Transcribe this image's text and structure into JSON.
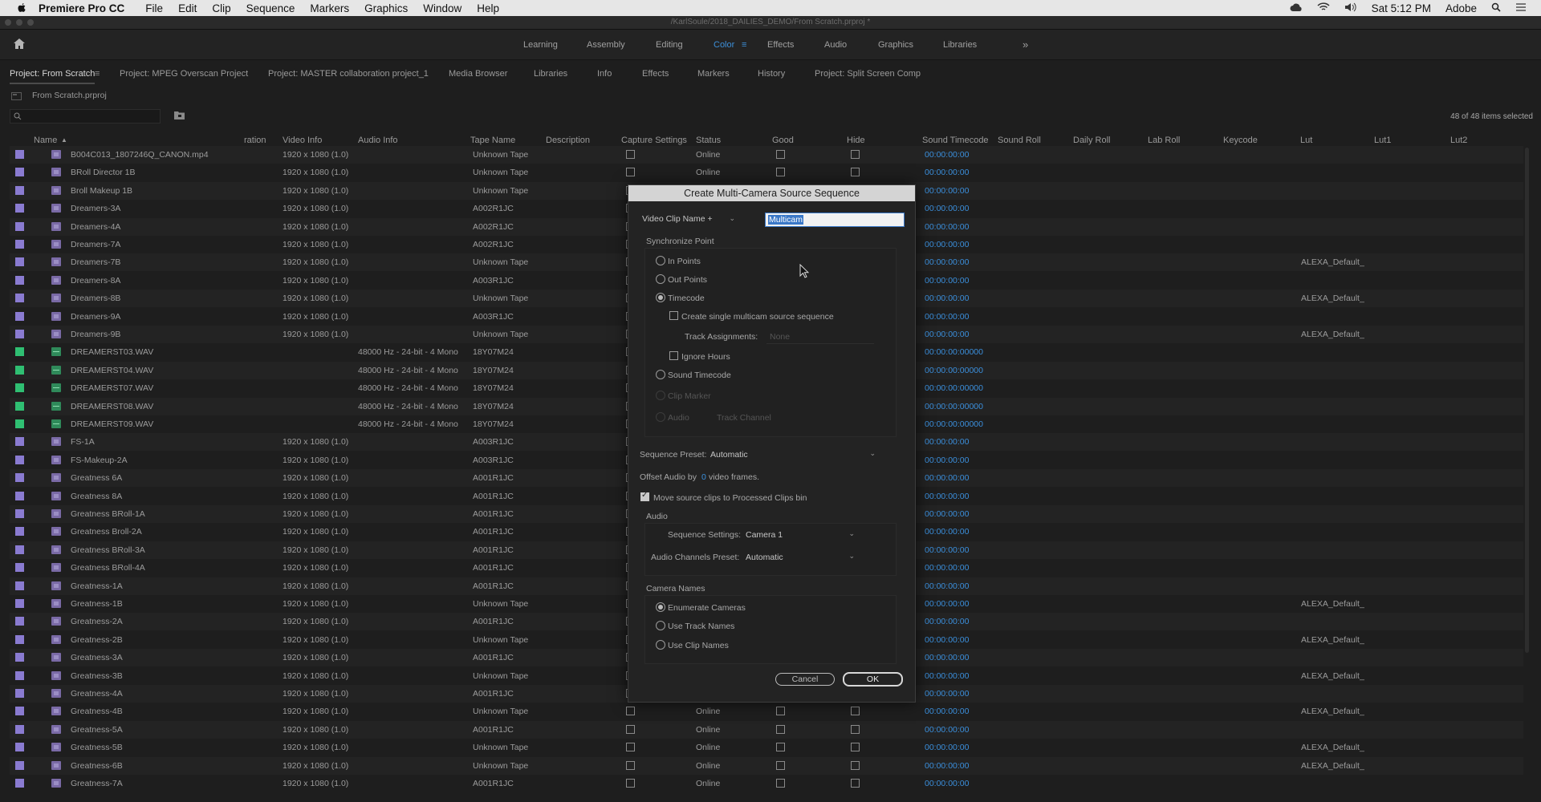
{
  "menubar": {
    "app": "Premiere Pro CC",
    "items": [
      "File",
      "Edit",
      "Clip",
      "Sequence",
      "Markers",
      "Graphics",
      "Window",
      "Help"
    ],
    "time": "Sat 5:12 PM",
    "user": "Adobe"
  },
  "titlebar": {
    "path": "/KarlSoule/2018_DAILIES_DEMO/From Scratch.prproj *"
  },
  "workspaces": [
    "Learning",
    "Assembly",
    "Editing",
    "Color",
    "Effects",
    "Audio",
    "Graphics",
    "Libraries"
  ],
  "active_workspace": "Color",
  "panel_tabs": [
    "Project: From Scratch",
    "Project: MPEG Overscan Project",
    "Project: MASTER collaboration project_1",
    "Media Browser",
    "Libraries",
    "Info",
    "Effects",
    "Markers",
    "History",
    "Project: Split Screen Comp"
  ],
  "project": {
    "file": "From Scratch.prproj",
    "selection": "48 of 48 items selected"
  },
  "columns": [
    "Name",
    "ration",
    "Video Info",
    "Audio Info",
    "Tape Name",
    "Description",
    "Capture Settings",
    "Status",
    "Good",
    "Hide",
    "Sound Timecode",
    "Sound Roll",
    "Daily Roll",
    "Lab Roll",
    "Keycode",
    "Lut",
    "Lut1",
    "Lut2"
  ],
  "rows": [
    {
      "name": "B004C013_1807246Q_CANON.mp4",
      "type": "video",
      "video": "1920 x 1080 (1.0)",
      "audio": "",
      "tape": "Unknown Tape",
      "status": "Online",
      "tc": "00:00:00:00",
      "lut": ""
    },
    {
      "name": "BRoll Director 1B",
      "type": "video",
      "video": "1920 x 1080 (1.0)",
      "audio": "",
      "tape": "Unknown Tape",
      "status": "Online",
      "tc": "00:00:00:00",
      "lut": ""
    },
    {
      "name": "Broll Makeup 1B",
      "type": "video",
      "video": "1920 x 1080 (1.0)",
      "audio": "",
      "tape": "Unknown Tape",
      "status": "",
      "tc": "00:00:00:00",
      "lut": ""
    },
    {
      "name": "Dreamers-3A",
      "type": "video",
      "video": "1920 x 1080 (1.0)",
      "audio": "",
      "tape": "A002R1JC",
      "status": "",
      "tc": "00:00:00:00",
      "lut": ""
    },
    {
      "name": "Dreamers-4A",
      "type": "video",
      "video": "1920 x 1080 (1.0)",
      "audio": "",
      "tape": "A002R1JC",
      "status": "",
      "tc": "00:00:00:00",
      "lut": ""
    },
    {
      "name": "Dreamers-7A",
      "type": "video",
      "video": "1920 x 1080 (1.0)",
      "audio": "",
      "tape": "A002R1JC",
      "status": "",
      "tc": "00:00:00:00",
      "lut": ""
    },
    {
      "name": "Dreamers-7B",
      "type": "video",
      "video": "1920 x 1080 (1.0)",
      "audio": "",
      "tape": "Unknown Tape",
      "status": "",
      "tc": "00:00:00:00",
      "lut": "ALEXA_Default_"
    },
    {
      "name": "Dreamers-8A",
      "type": "video",
      "video": "1920 x 1080 (1.0)",
      "audio": "",
      "tape": "A003R1JC",
      "status": "",
      "tc": "00:00:00:00",
      "lut": ""
    },
    {
      "name": "Dreamers-8B",
      "type": "video",
      "video": "1920 x 1080 (1.0)",
      "audio": "",
      "tape": "Unknown Tape",
      "status": "",
      "tc": "00:00:00:00",
      "lut": "ALEXA_Default_"
    },
    {
      "name": "Dreamers-9A",
      "type": "video",
      "video": "1920 x 1080 (1.0)",
      "audio": "",
      "tape": "A003R1JC",
      "status": "",
      "tc": "00:00:00:00",
      "lut": ""
    },
    {
      "name": "Dreamers-9B",
      "type": "video",
      "video": "1920 x 1080 (1.0)",
      "audio": "",
      "tape": "Unknown Tape",
      "status": "",
      "tc": "00:00:00:00",
      "lut": "ALEXA_Default_"
    },
    {
      "name": "DREAMERST03.WAV",
      "type": "audio",
      "video": "",
      "audio": "48000 Hz - 24-bit - 4 Mono",
      "tape": "18Y07M24",
      "status": "",
      "tc": "00:00:00:00000",
      "lut": ""
    },
    {
      "name": "DREAMERST04.WAV",
      "type": "audio",
      "video": "",
      "audio": "48000 Hz - 24-bit - 4 Mono",
      "tape": "18Y07M24",
      "status": "",
      "tc": "00:00:00:00000",
      "lut": ""
    },
    {
      "name": "DREAMERST07.WAV",
      "type": "audio",
      "video": "",
      "audio": "48000 Hz - 24-bit - 4 Mono",
      "tape": "18Y07M24",
      "status": "",
      "tc": "00:00:00:00000",
      "lut": ""
    },
    {
      "name": "DREAMERST08.WAV",
      "type": "audio",
      "video": "",
      "audio": "48000 Hz - 24-bit - 4 Mono",
      "tape": "18Y07M24",
      "status": "",
      "tc": "00:00:00:00000",
      "lut": ""
    },
    {
      "name": "DREAMERST09.WAV",
      "type": "audio",
      "video": "",
      "audio": "48000 Hz - 24-bit - 4 Mono",
      "tape": "18Y07M24",
      "status": "",
      "tc": "00:00:00:00000",
      "lut": ""
    },
    {
      "name": "FS-1A",
      "type": "video",
      "video": "1920 x 1080 (1.0)",
      "audio": "",
      "tape": "A003R1JC",
      "status": "",
      "tc": "00:00:00:00",
      "lut": ""
    },
    {
      "name": "FS-Makeup-2A",
      "type": "video",
      "video": "1920 x 1080 (1.0)",
      "audio": "",
      "tape": "A003R1JC",
      "status": "",
      "tc": "00:00:00:00",
      "lut": ""
    },
    {
      "name": "Greatness 6A",
      "type": "video",
      "video": "1920 x 1080 (1.0)",
      "audio": "",
      "tape": "A001R1JC",
      "status": "",
      "tc": "00:00:00:00",
      "lut": ""
    },
    {
      "name": "Greatness 8A",
      "type": "video",
      "video": "1920 x 1080 (1.0)",
      "audio": "",
      "tape": "A001R1JC",
      "status": "",
      "tc": "00:00:00:00",
      "lut": ""
    },
    {
      "name": "Greatness BRoll-1A",
      "type": "video",
      "video": "1920 x 1080 (1.0)",
      "audio": "",
      "tape": "A001R1JC",
      "status": "",
      "tc": "00:00:00:00",
      "lut": ""
    },
    {
      "name": "Greatness Broll-2A",
      "type": "video",
      "video": "1920 x 1080 (1.0)",
      "audio": "",
      "tape": "A001R1JC",
      "status": "",
      "tc": "00:00:00:00",
      "lut": ""
    },
    {
      "name": "Greatness BRoll-3A",
      "type": "video",
      "video": "1920 x 1080 (1.0)",
      "audio": "",
      "tape": "A001R1JC",
      "status": "",
      "tc": "00:00:00:00",
      "lut": ""
    },
    {
      "name": "Greatness BRoll-4A",
      "type": "video",
      "video": "1920 x 1080 (1.0)",
      "audio": "",
      "tape": "A001R1JC",
      "status": "",
      "tc": "00:00:00:00",
      "lut": ""
    },
    {
      "name": "Greatness-1A",
      "type": "video",
      "video": "1920 x 1080 (1.0)",
      "audio": "",
      "tape": "A001R1JC",
      "status": "",
      "tc": "00:00:00:00",
      "lut": ""
    },
    {
      "name": "Greatness-1B",
      "type": "video",
      "video": "1920 x 1080 (1.0)",
      "audio": "",
      "tape": "Unknown Tape",
      "status": "",
      "tc": "00:00:00:00",
      "lut": "ALEXA_Default_"
    },
    {
      "name": "Greatness-2A",
      "type": "video",
      "video": "1920 x 1080 (1.0)",
      "audio": "",
      "tape": "A001R1JC",
      "status": "",
      "tc": "00:00:00:00",
      "lut": ""
    },
    {
      "name": "Greatness-2B",
      "type": "video",
      "video": "1920 x 1080 (1.0)",
      "audio": "",
      "tape": "Unknown Tape",
      "status": "",
      "tc": "00:00:00:00",
      "lut": "ALEXA_Default_"
    },
    {
      "name": "Greatness-3A",
      "type": "video",
      "video": "1920 x 1080 (1.0)",
      "audio": "",
      "tape": "A001R1JC",
      "status": "",
      "tc": "00:00:00:00",
      "lut": ""
    },
    {
      "name": "Greatness-3B",
      "type": "video",
      "video": "1920 x 1080 (1.0)",
      "audio": "",
      "tape": "Unknown Tape",
      "status": "",
      "tc": "00:00:00:00",
      "lut": "ALEXA_Default_"
    },
    {
      "name": "Greatness-4A",
      "type": "video",
      "video": "1920 x 1080 (1.0)",
      "audio": "",
      "tape": "A001R1JC",
      "status": "",
      "tc": "00:00:00:00",
      "lut": ""
    },
    {
      "name": "Greatness-4B",
      "type": "video",
      "video": "1920 x 1080 (1.0)",
      "audio": "",
      "tape": "Unknown Tape",
      "status": "Online",
      "tc": "00:00:00:00",
      "lut": "ALEXA_Default_"
    },
    {
      "name": "Greatness-5A",
      "type": "video",
      "video": "1920 x 1080 (1.0)",
      "audio": "",
      "tape": "A001R1JC",
      "status": "Online",
      "tc": "00:00:00:00",
      "lut": ""
    },
    {
      "name": "Greatness-5B",
      "type": "video",
      "video": "1920 x 1080 (1.0)",
      "audio": "",
      "tape": "Unknown Tape",
      "status": "Online",
      "tc": "00:00:00:00",
      "lut": "ALEXA_Default_"
    },
    {
      "name": "Greatness-6B",
      "type": "video",
      "video": "1920 x 1080 (1.0)",
      "audio": "",
      "tape": "Unknown Tape",
      "status": "Online",
      "tc": "00:00:00:00",
      "lut": "ALEXA_Default_"
    },
    {
      "name": "Greatness-7A",
      "type": "video",
      "video": "1920 x 1080 (1.0)",
      "audio": "",
      "tape": "A001R1JC",
      "status": "Online",
      "tc": "00:00:00:00",
      "lut": ""
    }
  ],
  "dialog": {
    "title": "Create Multi-Camera Source Sequence",
    "name_dropdown": "Video Clip Name +",
    "name_value": "Multicam",
    "sync_label": "Synchronize Point",
    "opt_in": "In Points",
    "opt_out": "Out Points",
    "opt_tc": "Timecode",
    "single_seq": "Create single multicam source sequence",
    "track_assign_label": "Track Assignments:",
    "track_assign_value": "None",
    "ignore_hours": "Ignore Hours",
    "opt_sound_tc": "Sound Timecode",
    "opt_clip_marker": "Clip Marker",
    "opt_audio": "Audio",
    "track_channel": "Track Channel",
    "seq_preset_label": "Sequence Preset:",
    "seq_preset_value": "Automatic",
    "offset_pre": "Offset Audio by",
    "offset_value": "0",
    "offset_post": "video frames.",
    "move_clips": "Move source clips to Processed Clips bin",
    "audio_label": "Audio",
    "seq_settings_label": "Sequence Settings:",
    "seq_settings_value": "Camera 1",
    "audio_ch_label": "Audio Channels Preset:",
    "audio_ch_value": "Automatic",
    "camera_names_label": "Camera Names",
    "cam_enum": "Enumerate Cameras",
    "cam_track": "Use Track Names",
    "cam_clip": "Use Clip Names",
    "cancel": "Cancel",
    "ok": "OK"
  },
  "colors": {
    "accent": "#3b8fdc",
    "video_label": "#8a7bd1",
    "audio_label": "#2fbf72"
  }
}
